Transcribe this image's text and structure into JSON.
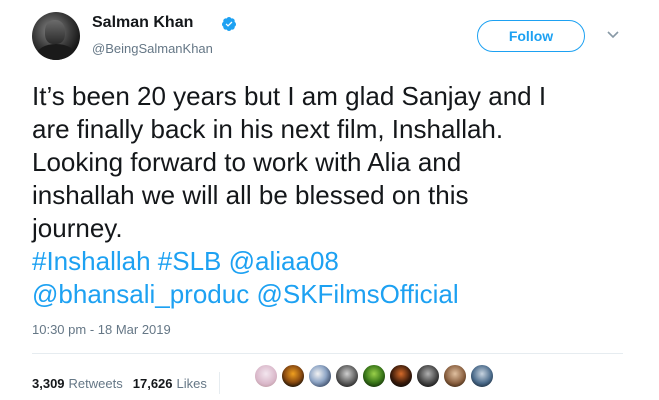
{
  "author": {
    "name": "Salman Khan",
    "handle": "@BeingSalmanKhan",
    "verified_icon": "verified-badge-icon",
    "avatar_icon": "profile-photo"
  },
  "actions": {
    "follow_label": "Follow",
    "menu_icon": "chevron-down-icon"
  },
  "tweet": {
    "lines": [
      "It’s been 20 years but I am glad Sanjay and I",
      "are finally back in his next film, Inshallah.",
      "Looking forward to work with Alia and",
      "inshallah we will all be blessed on this",
      "journey."
    ],
    "links_line1": [
      "#Inshallah",
      "#SLB",
      "@aliaa08"
    ],
    "links_line2": [
      "@bhansali_produc",
      "@SKFilmsOfficial"
    ]
  },
  "timestamp": "10:30 pm - 18 Mar 2019",
  "stats": {
    "retweets_count": "3,309",
    "retweets_label": "Retweets",
    "likes_count": "17,626",
    "likes_label": "Likes"
  },
  "colors": {
    "accent": "#1da1f2",
    "text": "#14171a",
    "muted": "#657786",
    "divider": "#e6ecf0"
  }
}
